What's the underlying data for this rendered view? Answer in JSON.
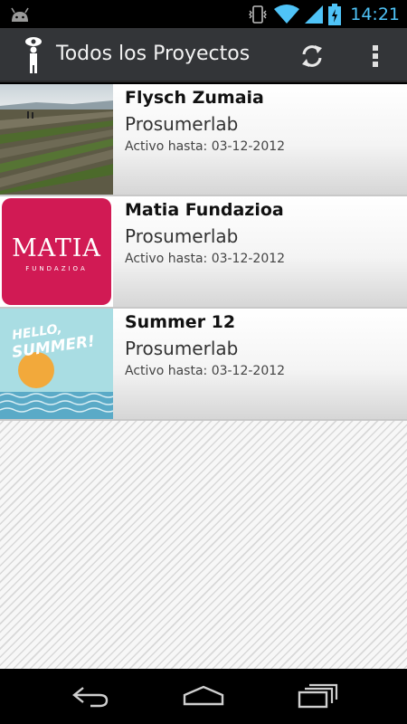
{
  "status_bar": {
    "time": "14:21"
  },
  "action_bar": {
    "title": "Todos los Proyectos"
  },
  "projects": [
    {
      "name": "Flysch Zumaia",
      "organization": "Prosumerlab",
      "active_until": "Activo hasta: 03-12-2012"
    },
    {
      "name": "Matia Fundazioa",
      "organization": "Prosumerlab",
      "active_until": "Activo hasta: 03-12-2012"
    },
    {
      "name": "Summer 12",
      "organization": "Prosumerlab",
      "active_until": "Activo hasta: 03-12-2012"
    }
  ],
  "thumbnails": {
    "matia_logo_word": "MATIA",
    "matia_logo_sub": "FUNDAZIOA",
    "summer_line1": "HELLO,",
    "summer_line2": "SUMMER!"
  },
  "colors": {
    "clock": "#4fc3f7",
    "action_bar": "#333538",
    "matia_brand": "#d11a54"
  },
  "icons": [
    "android-debug-icon",
    "vibrate-icon",
    "wifi-icon",
    "signal-icon",
    "battery-charging-icon",
    "app-logo-icon",
    "refresh-icon",
    "overflow-menu-icon",
    "back-icon",
    "home-icon",
    "recents-icon"
  ]
}
